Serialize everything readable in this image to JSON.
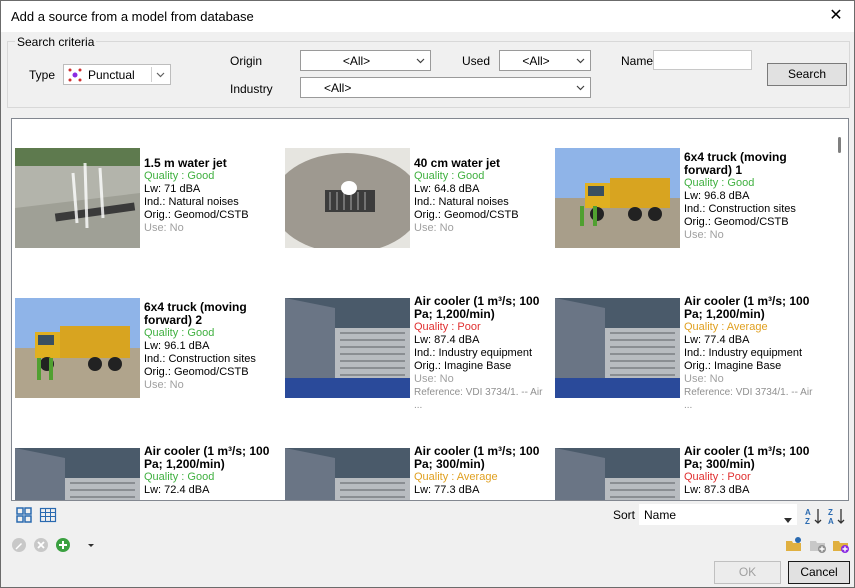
{
  "window": {
    "title": "Add a source from a model from database"
  },
  "criteria": {
    "legend": "Search criteria",
    "type_label": "Type",
    "type_value": "Punctual",
    "origin_label": "Origin",
    "origin_value": "<All>",
    "used_label": "Used",
    "used_value": "<All>",
    "name_label": "Name",
    "name_value": "",
    "industry_label": "Industry",
    "industry_value": "<All>",
    "search_button": "Search"
  },
  "items": [
    {
      "name1": "1.5 m water jet",
      "name2": "",
      "quality": "Quality : Good",
      "lw": "Lw: 71 dBA",
      "ind": "Ind.: Natural noises",
      "orig": "Orig.: Geomod/CSTB",
      "use": "Use: No",
      "ref": ""
    },
    {
      "name1": "40 cm water jet",
      "name2": "",
      "quality": "Quality : Good",
      "lw": "Lw: 64.8 dBA",
      "ind": "Ind.: Natural noises",
      "orig": "Orig.: Geomod/CSTB",
      "use": "Use: No",
      "ref": ""
    },
    {
      "name1": "6x4 truck (moving",
      "name2": "forward) 1",
      "quality": "Quality : Good",
      "lw": "Lw: 96.8 dBA",
      "ind": "Ind.: Construction sites",
      "orig": "Orig.: Geomod/CSTB",
      "use": "Use: No",
      "ref": ""
    },
    {
      "name1": "6x4 truck (moving",
      "name2": "forward) 2",
      "quality": "Quality : Good",
      "lw": "Lw: 96.1 dBA",
      "ind": "Ind.: Construction sites",
      "orig": "Orig.: Geomod/CSTB",
      "use": "Use: No",
      "ref": ""
    },
    {
      "name1": "Air cooler (1 m³/s; 100",
      "name2": "Pa; 1,200/min)",
      "quality": "Quality : Poor",
      "lw": "Lw: 87.4 dBA",
      "ind": "Ind.: Industry equipment",
      "orig": "Orig.: Imagine Base",
      "use": "Use: No",
      "ref": "Reference: VDI 3734/1. -- Air ..."
    },
    {
      "name1": "Air cooler (1 m³/s; 100",
      "name2": "Pa; 1,200/min)",
      "quality": "Quality : Average",
      "lw": "Lw: 77.4 dBA",
      "ind": "Ind.: Industry equipment",
      "orig": "Orig.: Imagine Base",
      "use": "Use: No",
      "ref": "Reference: VDI 3734/1. -- Air ..."
    },
    {
      "name1": "Air cooler (1 m³/s; 100",
      "name2": "Pa; 1,200/min)",
      "quality": "Quality : Good",
      "lw": "Lw: 72.4 dBA",
      "ind": "",
      "orig": "",
      "use": "",
      "ref": ""
    },
    {
      "name1": "Air cooler (1 m³/s; 100",
      "name2": "Pa; 300/min)",
      "quality": "Quality : Average",
      "lw": "Lw: 77.3 dBA",
      "ind": "",
      "orig": "",
      "use": "",
      "ref": ""
    },
    {
      "name1": "Air cooler (1 m³/s; 100",
      "name2": "Pa; 300/min)",
      "quality": "Quality : Poor",
      "lw": "Lw: 87.3 dBA",
      "ind": "",
      "orig": "",
      "use": "",
      "ref": ""
    }
  ],
  "sort": {
    "label": "Sort",
    "value": "Name"
  },
  "footer": {
    "ok_button": "OK",
    "cancel_button": "Cancel"
  },
  "colors": {
    "quality_good": "#40b040",
    "quality_poor": "#e03030",
    "quality_average": "#e0a020",
    "use_text": "#a0a0a0"
  }
}
